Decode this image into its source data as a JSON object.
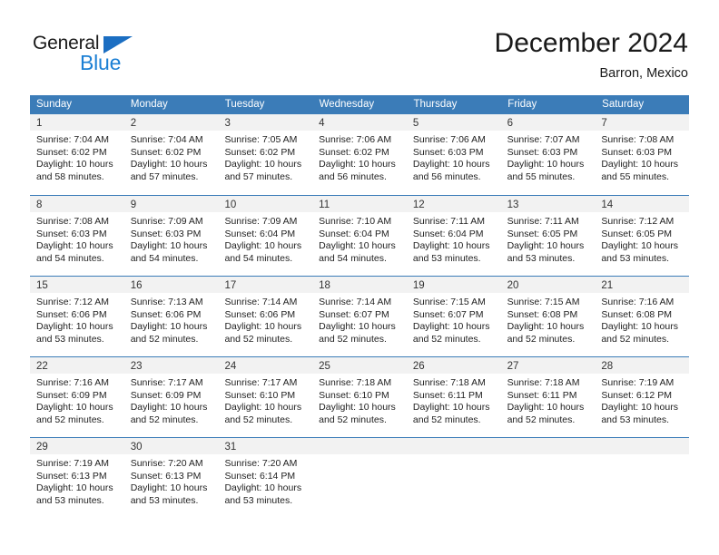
{
  "brand": {
    "name_top": "General",
    "name_bottom": "Blue",
    "triangle_color": "#1b6ec2",
    "blue_text_color": "#1b7fd4"
  },
  "header": {
    "title": "December 2024",
    "subtitle": "Barron, Mexico",
    "header_bg": "#3b7cb8",
    "daynum_band_bg": "#f2f2f2"
  },
  "weekday_headers": [
    "Sunday",
    "Monday",
    "Tuesday",
    "Wednesday",
    "Thursday",
    "Friday",
    "Saturday"
  ],
  "weeks": [
    [
      {
        "day": "1",
        "sunrise": "Sunrise: 7:04 AM",
        "sunset": "Sunset: 6:02 PM",
        "daylight1": "Daylight: 10 hours",
        "daylight2": "and 58 minutes."
      },
      {
        "day": "2",
        "sunrise": "Sunrise: 7:04 AM",
        "sunset": "Sunset: 6:02 PM",
        "daylight1": "Daylight: 10 hours",
        "daylight2": "and 57 minutes."
      },
      {
        "day": "3",
        "sunrise": "Sunrise: 7:05 AM",
        "sunset": "Sunset: 6:02 PM",
        "daylight1": "Daylight: 10 hours",
        "daylight2": "and 57 minutes."
      },
      {
        "day": "4",
        "sunrise": "Sunrise: 7:06 AM",
        "sunset": "Sunset: 6:02 PM",
        "daylight1": "Daylight: 10 hours",
        "daylight2": "and 56 minutes."
      },
      {
        "day": "5",
        "sunrise": "Sunrise: 7:06 AM",
        "sunset": "Sunset: 6:03 PM",
        "daylight1": "Daylight: 10 hours",
        "daylight2": "and 56 minutes."
      },
      {
        "day": "6",
        "sunrise": "Sunrise: 7:07 AM",
        "sunset": "Sunset: 6:03 PM",
        "daylight1": "Daylight: 10 hours",
        "daylight2": "and 55 minutes."
      },
      {
        "day": "7",
        "sunrise": "Sunrise: 7:08 AM",
        "sunset": "Sunset: 6:03 PM",
        "daylight1": "Daylight: 10 hours",
        "daylight2": "and 55 minutes."
      }
    ],
    [
      {
        "day": "8",
        "sunrise": "Sunrise: 7:08 AM",
        "sunset": "Sunset: 6:03 PM",
        "daylight1": "Daylight: 10 hours",
        "daylight2": "and 54 minutes."
      },
      {
        "day": "9",
        "sunrise": "Sunrise: 7:09 AM",
        "sunset": "Sunset: 6:03 PM",
        "daylight1": "Daylight: 10 hours",
        "daylight2": "and 54 minutes."
      },
      {
        "day": "10",
        "sunrise": "Sunrise: 7:09 AM",
        "sunset": "Sunset: 6:04 PM",
        "daylight1": "Daylight: 10 hours",
        "daylight2": "and 54 minutes."
      },
      {
        "day": "11",
        "sunrise": "Sunrise: 7:10 AM",
        "sunset": "Sunset: 6:04 PM",
        "daylight1": "Daylight: 10 hours",
        "daylight2": "and 54 minutes."
      },
      {
        "day": "12",
        "sunrise": "Sunrise: 7:11 AM",
        "sunset": "Sunset: 6:04 PM",
        "daylight1": "Daylight: 10 hours",
        "daylight2": "and 53 minutes."
      },
      {
        "day": "13",
        "sunrise": "Sunrise: 7:11 AM",
        "sunset": "Sunset: 6:05 PM",
        "daylight1": "Daylight: 10 hours",
        "daylight2": "and 53 minutes."
      },
      {
        "day": "14",
        "sunrise": "Sunrise: 7:12 AM",
        "sunset": "Sunset: 6:05 PM",
        "daylight1": "Daylight: 10 hours",
        "daylight2": "and 53 minutes."
      }
    ],
    [
      {
        "day": "15",
        "sunrise": "Sunrise: 7:12 AM",
        "sunset": "Sunset: 6:06 PM",
        "daylight1": "Daylight: 10 hours",
        "daylight2": "and 53 minutes."
      },
      {
        "day": "16",
        "sunrise": "Sunrise: 7:13 AM",
        "sunset": "Sunset: 6:06 PM",
        "daylight1": "Daylight: 10 hours",
        "daylight2": "and 52 minutes."
      },
      {
        "day": "17",
        "sunrise": "Sunrise: 7:14 AM",
        "sunset": "Sunset: 6:06 PM",
        "daylight1": "Daylight: 10 hours",
        "daylight2": "and 52 minutes."
      },
      {
        "day": "18",
        "sunrise": "Sunrise: 7:14 AM",
        "sunset": "Sunset: 6:07 PM",
        "daylight1": "Daylight: 10 hours",
        "daylight2": "and 52 minutes."
      },
      {
        "day": "19",
        "sunrise": "Sunrise: 7:15 AM",
        "sunset": "Sunset: 6:07 PM",
        "daylight1": "Daylight: 10 hours",
        "daylight2": "and 52 minutes."
      },
      {
        "day": "20",
        "sunrise": "Sunrise: 7:15 AM",
        "sunset": "Sunset: 6:08 PM",
        "daylight1": "Daylight: 10 hours",
        "daylight2": "and 52 minutes."
      },
      {
        "day": "21",
        "sunrise": "Sunrise: 7:16 AM",
        "sunset": "Sunset: 6:08 PM",
        "daylight1": "Daylight: 10 hours",
        "daylight2": "and 52 minutes."
      }
    ],
    [
      {
        "day": "22",
        "sunrise": "Sunrise: 7:16 AM",
        "sunset": "Sunset: 6:09 PM",
        "daylight1": "Daylight: 10 hours",
        "daylight2": "and 52 minutes."
      },
      {
        "day": "23",
        "sunrise": "Sunrise: 7:17 AM",
        "sunset": "Sunset: 6:09 PM",
        "daylight1": "Daylight: 10 hours",
        "daylight2": "and 52 minutes."
      },
      {
        "day": "24",
        "sunrise": "Sunrise: 7:17 AM",
        "sunset": "Sunset: 6:10 PM",
        "daylight1": "Daylight: 10 hours",
        "daylight2": "and 52 minutes."
      },
      {
        "day": "25",
        "sunrise": "Sunrise: 7:18 AM",
        "sunset": "Sunset: 6:10 PM",
        "daylight1": "Daylight: 10 hours",
        "daylight2": "and 52 minutes."
      },
      {
        "day": "26",
        "sunrise": "Sunrise: 7:18 AM",
        "sunset": "Sunset: 6:11 PM",
        "daylight1": "Daylight: 10 hours",
        "daylight2": "and 52 minutes."
      },
      {
        "day": "27",
        "sunrise": "Sunrise: 7:18 AM",
        "sunset": "Sunset: 6:11 PM",
        "daylight1": "Daylight: 10 hours",
        "daylight2": "and 52 minutes."
      },
      {
        "day": "28",
        "sunrise": "Sunrise: 7:19 AM",
        "sunset": "Sunset: 6:12 PM",
        "daylight1": "Daylight: 10 hours",
        "daylight2": "and 53 minutes."
      }
    ],
    [
      {
        "day": "29",
        "sunrise": "Sunrise: 7:19 AM",
        "sunset": "Sunset: 6:13 PM",
        "daylight1": "Daylight: 10 hours",
        "daylight2": "and 53 minutes."
      },
      {
        "day": "30",
        "sunrise": "Sunrise: 7:20 AM",
        "sunset": "Sunset: 6:13 PM",
        "daylight1": "Daylight: 10 hours",
        "daylight2": "and 53 minutes."
      },
      {
        "day": "31",
        "sunrise": "Sunrise: 7:20 AM",
        "sunset": "Sunset: 6:14 PM",
        "daylight1": "Daylight: 10 hours",
        "daylight2": "and 53 minutes."
      },
      {
        "day": "",
        "sunrise": "",
        "sunset": "",
        "daylight1": "",
        "daylight2": ""
      },
      {
        "day": "",
        "sunrise": "",
        "sunset": "",
        "daylight1": "",
        "daylight2": ""
      },
      {
        "day": "",
        "sunrise": "",
        "sunset": "",
        "daylight1": "",
        "daylight2": ""
      },
      {
        "day": "",
        "sunrise": "",
        "sunset": "",
        "daylight1": "",
        "daylight2": ""
      }
    ]
  ]
}
